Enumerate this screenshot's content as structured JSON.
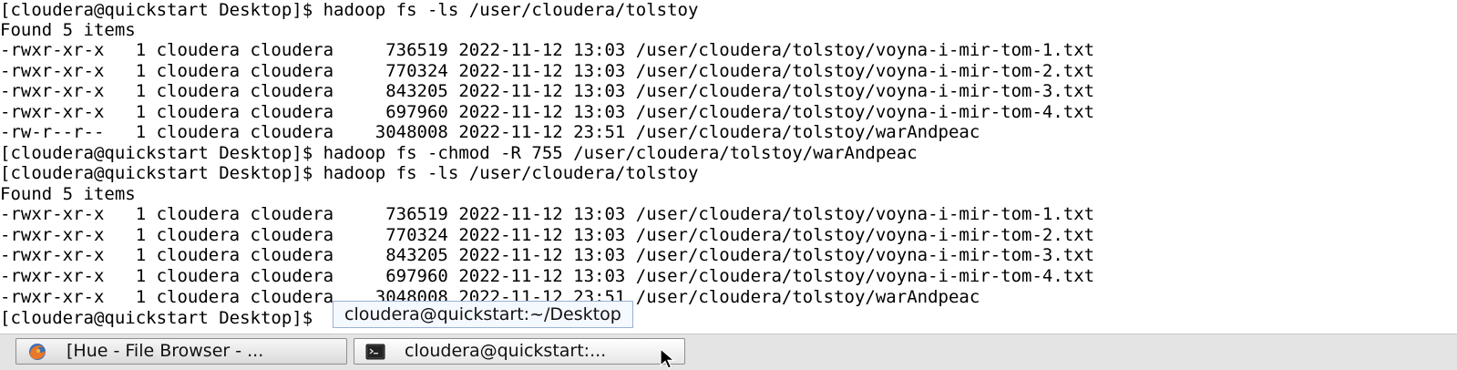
{
  "terminal": {
    "lines": [
      "[cloudera@quickstart Desktop]$ hadoop fs -ls /user/cloudera/tolstoy",
      "Found 5 items",
      "-rwxr-xr-x   1 cloudera cloudera     736519 2022-11-12 13:03 /user/cloudera/tolstoy/voyna-i-mir-tom-1.txt",
      "-rwxr-xr-x   1 cloudera cloudera     770324 2022-11-12 13:03 /user/cloudera/tolstoy/voyna-i-mir-tom-2.txt",
      "-rwxr-xr-x   1 cloudera cloudera     843205 2022-11-12 13:03 /user/cloudera/tolstoy/voyna-i-mir-tom-3.txt",
      "-rwxr-xr-x   1 cloudera cloudera     697960 2022-11-12 13:03 /user/cloudera/tolstoy/voyna-i-mir-tom-4.txt",
      "-rw-r--r--   1 cloudera cloudera    3048008 2022-11-12 23:51 /user/cloudera/tolstoy/warAndpeac",
      "[cloudera@quickstart Desktop]$ hadoop fs -chmod -R 755 /user/cloudera/tolstoy/warAndpeac",
      "[cloudera@quickstart Desktop]$ hadoop fs -ls /user/cloudera/tolstoy",
      "Found 5 items",
      "-rwxr-xr-x   1 cloudera cloudera     736519 2022-11-12 13:03 /user/cloudera/tolstoy/voyna-i-mir-tom-1.txt",
      "-rwxr-xr-x   1 cloudera cloudera     770324 2022-11-12 13:03 /user/cloudera/tolstoy/voyna-i-mir-tom-2.txt",
      "-rwxr-xr-x   1 cloudera cloudera     843205 2022-11-12 13:03 /user/cloudera/tolstoy/voyna-i-mir-tom-3.txt",
      "-rwxr-xr-x   1 cloudera cloudera     697960 2022-11-12 13:03 /user/cloudera/tolstoy/voyna-i-mir-tom-4.txt",
      "-rwxr-xr-x   1 cloudera cloudera    3048008 2022-11-12 23:51 /user/cloudera/tolstoy/warAndpeac",
      "[cloudera@quickstart Desktop]$ "
    ]
  },
  "tooltip": {
    "text": "cloudera@quickstart:~/Desktop"
  },
  "taskbar": {
    "tasks": [
      {
        "label": "[Hue - File Browser - ...",
        "icon": "firefox-icon"
      },
      {
        "label": "cloudera@quickstart:...",
        "icon": "terminal-icon"
      }
    ]
  }
}
